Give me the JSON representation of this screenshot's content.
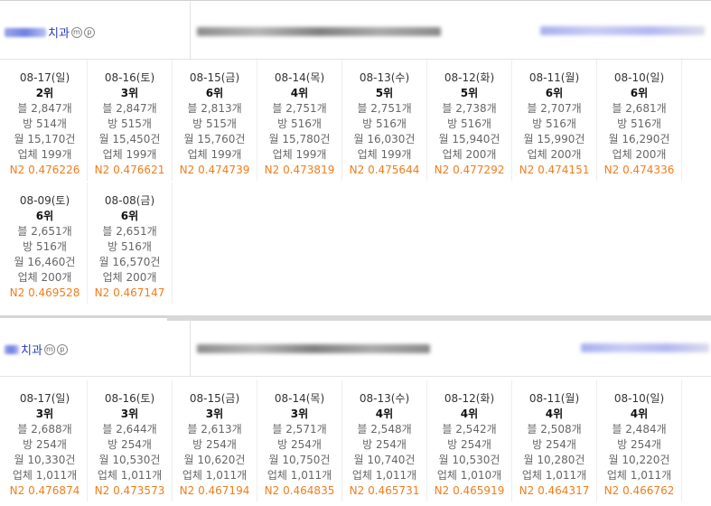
{
  "sections": [
    {
      "clinic_suffix": "치과",
      "mark_m": "m",
      "mark_p": "p",
      "rows": [
        [
          {
            "date": "08-17(일)",
            "rank": "2위",
            "blog": "블 2,847개",
            "bang": "방 514개",
            "month": "월 15,170건",
            "biz": "업체 199개",
            "n2": "N2 0.476226"
          },
          {
            "date": "08-16(토)",
            "rank": "3위",
            "blog": "블 2,847개",
            "bang": "방 515개",
            "month": "월 15,450건",
            "biz": "업체 199개",
            "n2": "N2 0.476621"
          },
          {
            "date": "08-15(금)",
            "rank": "6위",
            "blog": "블 2,813개",
            "bang": "방 515개",
            "month": "월 15,760건",
            "biz": "업체 199개",
            "n2": "N2 0.474739"
          },
          {
            "date": "08-14(목)",
            "rank": "4위",
            "blog": "블 2,751개",
            "bang": "방 516개",
            "month": "월 15,780건",
            "biz": "업체 199개",
            "n2": "N2 0.473819"
          },
          {
            "date": "08-13(수)",
            "rank": "5위",
            "blog": "블 2,751개",
            "bang": "방 516개",
            "month": "월 16,030건",
            "biz": "업체 199개",
            "n2": "N2 0.475644"
          },
          {
            "date": "08-12(화)",
            "rank": "5위",
            "blog": "블 2,738개",
            "bang": "방 516개",
            "month": "월 15,940건",
            "biz": "업체 200개",
            "n2": "N2 0.477292"
          },
          {
            "date": "08-11(월)",
            "rank": "6위",
            "blog": "블 2,707개",
            "bang": "방 516개",
            "month": "월 15,990건",
            "biz": "업체 200개",
            "n2": "N2 0.474151"
          },
          {
            "date": "08-10(일)",
            "rank": "6위",
            "blog": "블 2,681개",
            "bang": "방 516개",
            "month": "월 16,290건",
            "biz": "업체 200개",
            "n2": "N2 0.474336"
          }
        ],
        [
          {
            "date": "08-09(토)",
            "rank": "6위",
            "blog": "블 2,651개",
            "bang": "방 516개",
            "month": "월 16,460건",
            "biz": "업체 200개",
            "n2": "N2 0.469528"
          },
          {
            "date": "08-08(금)",
            "rank": "6위",
            "blog": "블 2,651개",
            "bang": "방 516개",
            "month": "월 16,570건",
            "biz": "업체 200개",
            "n2": "N2 0.467147"
          }
        ]
      ]
    },
    {
      "clinic_suffix": "치과",
      "mark_m": "m",
      "mark_p": "p",
      "rows": [
        [
          {
            "date": "08-17(일)",
            "rank": "3위",
            "blog": "블 2,688개",
            "bang": "방 254개",
            "month": "월 10,330건",
            "biz": "업체 1,011개",
            "n2": "N2 0.476874"
          },
          {
            "date": "08-16(토)",
            "rank": "3위",
            "blog": "블 2,644개",
            "bang": "방 254개",
            "month": "월 10,530건",
            "biz": "업체 1,011개",
            "n2": "N2 0.473573"
          },
          {
            "date": "08-15(금)",
            "rank": "3위",
            "blog": "블 2,613개",
            "bang": "방 254개",
            "month": "월 10,620건",
            "biz": "업체 1,011개",
            "n2": "N2 0.467194"
          },
          {
            "date": "08-14(목)",
            "rank": "3위",
            "blog": "블 2,571개",
            "bang": "방 254개",
            "month": "월 10,750건",
            "biz": "업체 1,011개",
            "n2": "N2 0.464835"
          },
          {
            "date": "08-13(수)",
            "rank": "4위",
            "blog": "블 2,548개",
            "bang": "방 254개",
            "month": "월 10,740건",
            "biz": "업체 1,011개",
            "n2": "N2 0.465731"
          },
          {
            "date": "08-12(화)",
            "rank": "4위",
            "blog": "블 2,542개",
            "bang": "방 254개",
            "month": "월 10,530건",
            "biz": "업체 1,010개",
            "n2": "N2 0.465919"
          },
          {
            "date": "08-11(월)",
            "rank": "4위",
            "blog": "블 2,508개",
            "bang": "방 254개",
            "month": "월 10,280건",
            "biz": "업체 1,011개",
            "n2": "N2 0.464317"
          },
          {
            "date": "08-10(일)",
            "rank": "4위",
            "blog": "블 2,484개",
            "bang": "방 254개",
            "month": "월 10,220건",
            "biz": "업체 1,011개",
            "n2": "N2 0.466762"
          }
        ]
      ]
    }
  ]
}
